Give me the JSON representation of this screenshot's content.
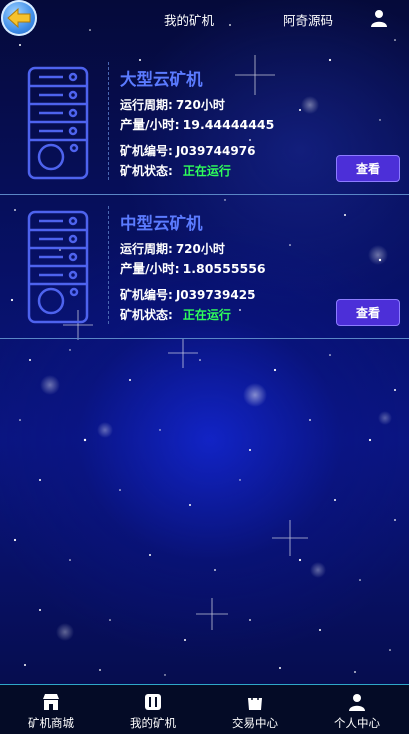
{
  "header": {
    "my_mining_label": "我的矿机",
    "aqi_label": "阿奇源码"
  },
  "machines": [
    {
      "title": "大型云矿机",
      "cycle_label": "运行周期:",
      "cycle_value": "720小时",
      "output_label": "产量/小时:",
      "output_value": "19.44444445",
      "id_label": "矿机编号:",
      "id_value": "J039744976",
      "status_label": "矿机状态:",
      "status_value": "正在运行",
      "button_label": "查看"
    },
    {
      "title": "中型云矿机",
      "cycle_label": "运行周期:",
      "cycle_value": "720小时",
      "output_label": "产量/小时:",
      "output_value": "1.80555556",
      "id_label": "矿机编号:",
      "id_value": "J039739425",
      "status_label": "矿机状态:",
      "status_value": "正在运行",
      "button_label": "查看"
    }
  ],
  "footer": {
    "items": [
      {
        "label": "矿机商城",
        "icon": "store-icon"
      },
      {
        "label": "我的矿机",
        "icon": "miner-icon"
      },
      {
        "label": "交易中心",
        "icon": "shopping-bag-icon"
      },
      {
        "label": "个人中心",
        "icon": "user-icon"
      }
    ]
  },
  "colors": {
    "accent": "#5b7bff",
    "status": "#2fff5a",
    "button": "#4c2fd8",
    "footer_border": "#2fa7c8"
  }
}
